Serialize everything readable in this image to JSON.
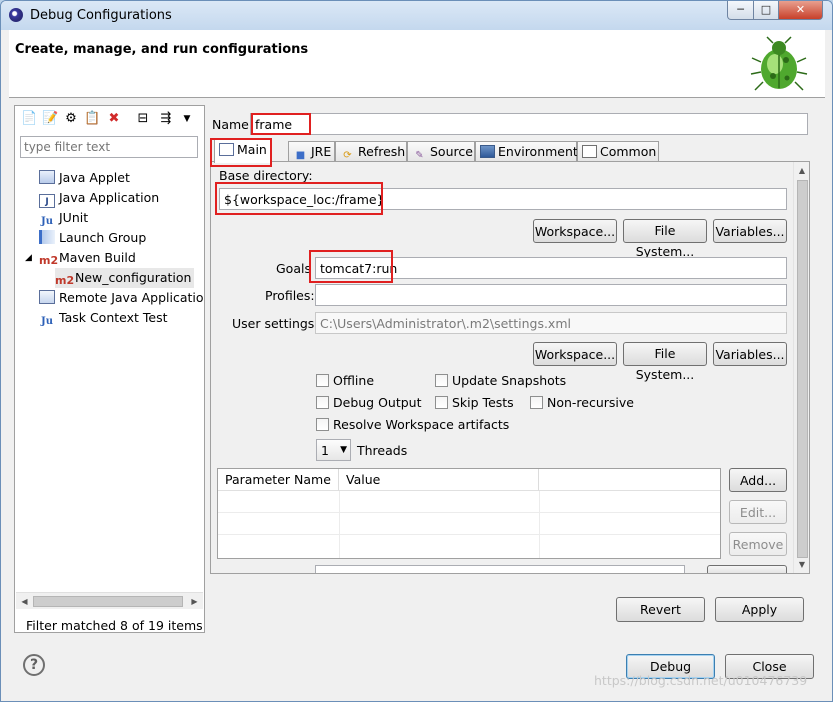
{
  "window": {
    "title": "Debug Configurations",
    "min_label": "─",
    "max_label": "□",
    "close_label": "✕"
  },
  "header": {
    "title": "Create, manage, and run configurations"
  },
  "filter": {
    "placeholder": "type filter text",
    "status": "Filter matched 8 of 19 items"
  },
  "tree": {
    "items": [
      {
        "label": "Java Applet",
        "icon": "java-applet-icon"
      },
      {
        "label": "Java Application",
        "icon": "java-application-icon"
      },
      {
        "label": "JUnit",
        "icon": "junit-icon"
      },
      {
        "label": "Launch Group",
        "icon": "launch-group-icon"
      },
      {
        "label": "Maven Build",
        "icon": "maven-m2-icon",
        "expanded": true
      },
      {
        "label": "New_configuration",
        "icon": "maven-m2-icon",
        "selected": true
      },
      {
        "label": "Remote Java Applicatio",
        "icon": "remote-java-icon"
      },
      {
        "label": "Task Context Test",
        "icon": "task-context-icon"
      }
    ],
    "m2_text": "m2",
    "j_text": "J",
    "ju_text": "Ju"
  },
  "config": {
    "name_label": "Name:",
    "name_value": "frame",
    "tabs": [
      {
        "label": "Main",
        "icon": "main-tab-icon",
        "active": true
      },
      {
        "label": "JRE",
        "icon": "jre-icon"
      },
      {
        "label": "Refresh",
        "icon": "refresh-icon"
      },
      {
        "label": "Source",
        "icon": "source-icon"
      },
      {
        "label": "Environment",
        "icon": "environment-icon"
      },
      {
        "label": "Common",
        "icon": "common-icon"
      }
    ],
    "base_dir_label": "Base directory:",
    "base_dir_value": "${workspace_loc:/frame}",
    "workspace_button": "Workspace...",
    "filesystem_button": "File System...",
    "variables_button": "Variables...",
    "goals_label": "Goals",
    "goals_value": "tomcat7:run",
    "profiles_label": "Profiles:",
    "profiles_value": "",
    "user_settings_label": "User settings:",
    "user_settings_value": "C:\\Users\\Administrator\\.m2\\settings.xml",
    "checkboxes": {
      "offline": {
        "label": "Offline",
        "checked": false
      },
      "update_snapshots": {
        "label": "Update Snapshots",
        "checked": false
      },
      "debug_output": {
        "label": "Debug Output",
        "checked": false
      },
      "skip_tests": {
        "label": "Skip Tests",
        "checked": false
      },
      "non_recursive": {
        "label": "Non-recursive",
        "checked": false
      },
      "resolve_workspace": {
        "label": "Resolve Workspace artifacts",
        "checked": false
      }
    },
    "threads_value": "1",
    "threads_label": "Threads",
    "param_table": {
      "columns": [
        "Parameter Name",
        "Value"
      ],
      "rows": []
    },
    "add_button": "Add...",
    "edit_button": "Edit...",
    "remove_button": "Remove"
  },
  "footer": {
    "revert_button": "Revert",
    "apply_button": "Apply",
    "debug_button": "Debug",
    "close_button": "Close",
    "help_label": "?",
    "watermark": "https://blog.csdn.net/u010476739"
  },
  "colors": {
    "highlight": "#e02020",
    "accent": "#3c7fb1"
  }
}
